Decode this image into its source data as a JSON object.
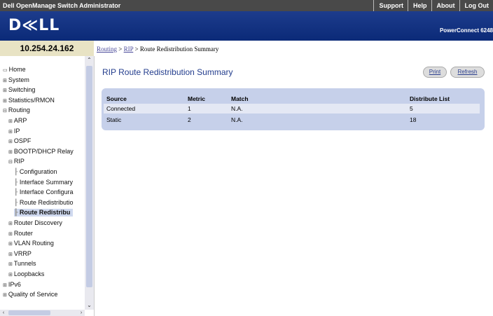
{
  "app": {
    "title": "Dell OpenManage Switch Administrator",
    "links": [
      "Support",
      "Help",
      "About",
      "Log Out"
    ],
    "logo": "D≪LL",
    "product": "PowerConnect 6248"
  },
  "device_ip": "10.254.24.162",
  "breadcrumb": {
    "items": [
      "Routing",
      "RIP"
    ],
    "current": "Route Redistribution Summary",
    "sep": ">"
  },
  "nav": [
    {
      "label": "Home",
      "icon": "folder-icon",
      "level": 0
    },
    {
      "label": "System",
      "icon": "expand-icon",
      "level": 0
    },
    {
      "label": "Switching",
      "icon": "expand-icon",
      "level": 0
    },
    {
      "label": "Statistics/RMON",
      "icon": "expand-icon",
      "level": 0
    },
    {
      "label": "Routing",
      "icon": "collapse-icon",
      "level": 0
    },
    {
      "label": "ARP",
      "icon": "expand-icon",
      "level": 1
    },
    {
      "label": "IP",
      "icon": "expand-icon",
      "level": 1
    },
    {
      "label": "OSPF",
      "icon": "expand-icon",
      "level": 1
    },
    {
      "label": "BOOTP/DHCP Relay",
      "icon": "expand-icon",
      "level": 1
    },
    {
      "label": "RIP",
      "icon": "collapse-icon",
      "level": 1
    },
    {
      "label": "Configuration",
      "icon": "",
      "level": 2
    },
    {
      "label": "Interface Summary",
      "icon": "",
      "level": 2
    },
    {
      "label": "Interface Configura",
      "icon": "",
      "level": 2
    },
    {
      "label": "Route Redistributio",
      "icon": "",
      "level": 2
    },
    {
      "label": "Route Redistribu",
      "icon": "",
      "level": 2,
      "selected": true
    },
    {
      "label": "Router Discovery",
      "icon": "expand-icon",
      "level": 1
    },
    {
      "label": "Router",
      "icon": "expand-icon",
      "level": 1
    },
    {
      "label": "VLAN Routing",
      "icon": "expand-icon",
      "level": 1
    },
    {
      "label": "VRRP",
      "icon": "expand-icon",
      "level": 1
    },
    {
      "label": "Tunnels",
      "icon": "expand-icon",
      "level": 1
    },
    {
      "label": "Loopbacks",
      "icon": "expand-icon",
      "level": 1
    },
    {
      "label": "IPv6",
      "icon": "expand-icon",
      "level": 0
    },
    {
      "label": "Quality of Service",
      "icon": "expand-icon",
      "level": 0
    }
  ],
  "page": {
    "title": "RIP Route Redistribution Summary",
    "print_label": "Print",
    "refresh_label": "Refresh"
  },
  "table": {
    "headers": [
      "Source",
      "Metric",
      "Match",
      "Distribute List"
    ],
    "rows": [
      [
        "Connected",
        "1",
        "N.A.",
        "5"
      ],
      [
        "Static",
        "2",
        "N.A.",
        "18"
      ]
    ]
  },
  "colors": {
    "banner": "#0b2a78",
    "topbar": "#494949",
    "title": "#233d8d",
    "panel": "#c6d0ea"
  }
}
